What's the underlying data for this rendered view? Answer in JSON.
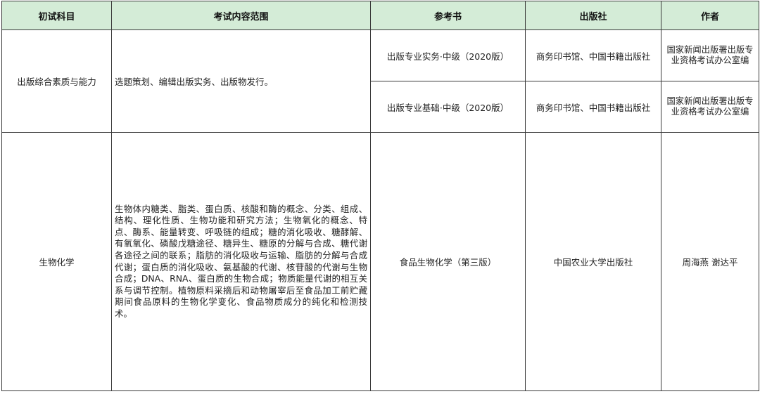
{
  "header": {
    "subject": "初试科目",
    "scope": "考试内容范围",
    "reference_book": "参考书",
    "publisher": "出版社",
    "author": "作者"
  },
  "rows": [
    {
      "subject": "出版综合素质与能力",
      "scope": "选题策划、编辑出版实务、出版物发行。",
      "books": [
        {
          "title": "出版专业实务·中级（2020版）",
          "publisher": "商务印书馆、中国书籍出版社",
          "author": "国家新闻出版署出版专业资格考试办公室编"
        },
        {
          "title": "出版专业基础·中级（2020版）",
          "publisher": "商务印书馆、中国书籍出版社",
          "author": "国家新闻出版署出版专业资格考试办公室编"
        }
      ]
    },
    {
      "subject": "生物化学",
      "scope": "生物体内糖类、脂类、蛋白质、核酸和酶的概念、分类、组成、结构、理化性质、生物功能和研究方法；生物氧化的概念、特点、酶系、能量转变、呼吸链的组成；糖的消化吸收、糖酵解、有氧氧化、磷酸戊糖途径、糖异生、糖原的分解与合成、糖代谢各途径之间的联系；脂肪的消化吸收与运输、脂肪的分解与合成代谢；蛋白质的消化吸收、氨基酸的代谢、核苷酸的代谢与生物合成；DNA、RNA、蛋白质的生物合成；物质能量代谢的相互关系与调节控制。植物原料采摘后和动物屠宰后至食品加工前贮藏期间食品原料的生物化学变化、食品物质成分的纯化和检测技术。",
      "books": [
        {
          "title": "食品生物化学（第三版）",
          "publisher": "中国农业大学出版社",
          "author": "周海燕 谢达平"
        }
      ]
    }
  ],
  "colors": {
    "header_bg": "#d4ecd7",
    "border": "#3a3a3a"
  }
}
